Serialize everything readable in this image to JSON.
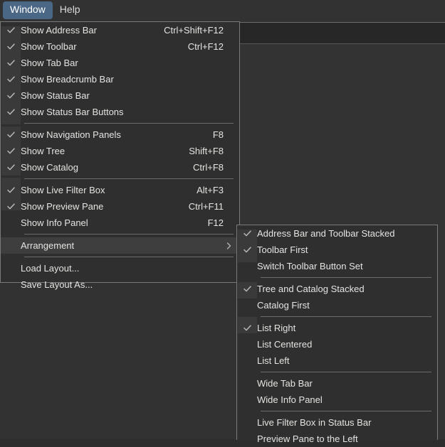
{
  "menubar": {
    "items": [
      {
        "label": "Window",
        "active": true
      },
      {
        "label": "Help",
        "active": false
      }
    ]
  },
  "window_menu": {
    "name": "Window",
    "groups": [
      {
        "items": [
          {
            "label": "Show Address Bar",
            "shortcut": "Ctrl+Shift+F12",
            "checked": true,
            "icon": "check-icon"
          },
          {
            "label": "Show Toolbar",
            "shortcut": "Ctrl+F12",
            "checked": true,
            "icon": "check-icon"
          },
          {
            "label": "Show Tab Bar",
            "shortcut": "",
            "checked": true,
            "icon": "check-icon"
          },
          {
            "label": "Show Breadcrumb Bar",
            "shortcut": "",
            "checked": true,
            "icon": "check-icon"
          },
          {
            "label": "Show Status Bar",
            "shortcut": "",
            "checked": true,
            "icon": "check-icon"
          },
          {
            "label": "Show Status Bar Buttons",
            "shortcut": "",
            "checked": true,
            "icon": "check-icon"
          }
        ]
      },
      {
        "items": [
          {
            "label": "Show Navigation Panels",
            "shortcut": "F8",
            "checked": true,
            "icon": "check-icon"
          },
          {
            "label": "Show Tree",
            "shortcut": "Shift+F8",
            "checked": true,
            "icon": "check-icon"
          },
          {
            "label": "Show Catalog",
            "shortcut": "Ctrl+F8",
            "checked": true,
            "icon": "check-icon"
          }
        ]
      },
      {
        "items": [
          {
            "label": "Show Live Filter Box",
            "shortcut": "Alt+F3",
            "checked": true,
            "icon": "check-icon"
          },
          {
            "label": "Show Preview Pane",
            "shortcut": "Ctrl+F11",
            "checked": true,
            "icon": "check-icon"
          },
          {
            "label": "Show Info Panel",
            "shortcut": "F12",
            "checked": false,
            "icon": ""
          }
        ]
      },
      {
        "items": [
          {
            "label": "Arrangement",
            "shortcut": "",
            "checked": false,
            "icon": "chevron-right-icon",
            "submenu": true,
            "highlighted": true
          }
        ]
      },
      {
        "items": [
          {
            "label": "Load Layout...",
            "shortcut": "",
            "checked": false,
            "icon": ""
          },
          {
            "label": "Save Layout As...",
            "shortcut": "",
            "checked": false,
            "icon": ""
          }
        ]
      }
    ]
  },
  "arrangement_submenu": {
    "name": "Arrangement",
    "groups": [
      {
        "items": [
          {
            "label": "Address Bar and Toolbar Stacked",
            "checked": true,
            "icon": "check-icon"
          },
          {
            "label": "Toolbar First",
            "checked": true,
            "icon": "check-icon"
          },
          {
            "label": "Switch Toolbar Button Set",
            "checked": false,
            "icon": ""
          }
        ]
      },
      {
        "items": [
          {
            "label": "Tree and Catalog Stacked",
            "checked": true,
            "icon": "check-icon"
          },
          {
            "label": "Catalog First",
            "checked": false,
            "icon": ""
          }
        ]
      },
      {
        "items": [
          {
            "label": "List Right",
            "checked": true,
            "icon": "check-icon"
          },
          {
            "label": "List Centered",
            "checked": false,
            "icon": ""
          },
          {
            "label": "List Left",
            "checked": false,
            "icon": ""
          }
        ]
      },
      {
        "items": [
          {
            "label": "Wide Tab Bar",
            "checked": false,
            "icon": ""
          },
          {
            "label": "Wide Info Panel",
            "checked": false,
            "icon": ""
          }
        ]
      },
      {
        "items": [
          {
            "label": "Live Filter Box in Status Bar",
            "checked": false,
            "icon": ""
          },
          {
            "label": "Preview Pane to the Left",
            "checked": false,
            "icon": ""
          }
        ]
      }
    ]
  },
  "colors": {
    "app_background": "#323232",
    "menu_background": "#2f2f2f",
    "menu_border": "#7a7a7a",
    "gutter": "#3a3a3a",
    "highlight": "#3e3e3e",
    "accent": "#4a6785",
    "text": "#e6e4e1",
    "separator": "#6a6a6a"
  }
}
